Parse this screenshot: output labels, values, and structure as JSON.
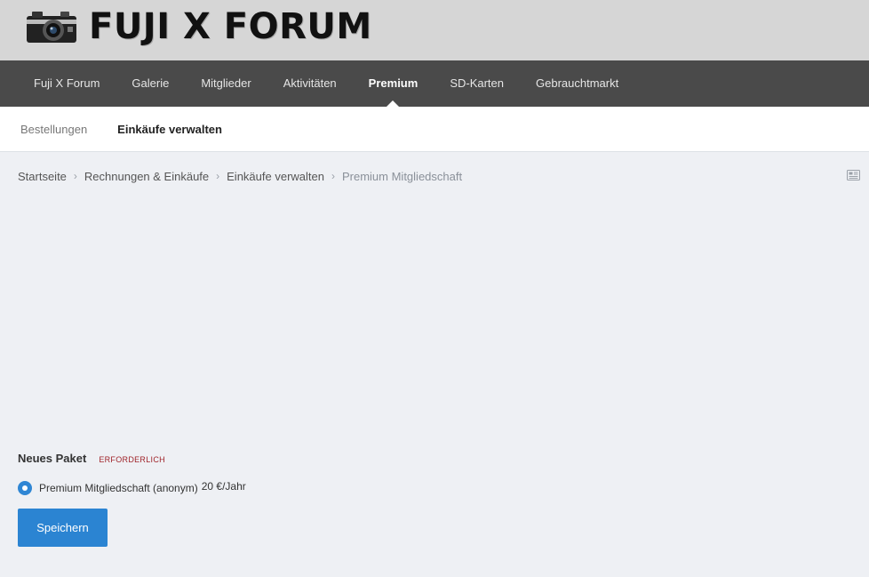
{
  "header": {
    "logo_text": "FUJI X FORUM"
  },
  "nav": {
    "items": [
      {
        "label": "Fuji X Forum"
      },
      {
        "label": "Galerie"
      },
      {
        "label": "Mitglieder"
      },
      {
        "label": "Aktivitäten"
      },
      {
        "label": "Premium",
        "active": true
      },
      {
        "label": "SD-Karten"
      },
      {
        "label": "Gebrauchtmarkt"
      }
    ]
  },
  "subnav": {
    "items": [
      {
        "label": "Bestellungen"
      },
      {
        "label": "Einkäufe verwalten",
        "active": true
      }
    ]
  },
  "breadcrumb": {
    "items": [
      "Startseite",
      "Rechnungen & Einkäufe",
      "Einkäufe verwalten",
      "Premium Mitgliedschaft"
    ]
  },
  "form": {
    "label": "Neues Paket",
    "required": "ERFORDERLICH",
    "option_label": "Premium Mitgliedschaft (anonym)",
    "option_price": "20 €/Jahr",
    "option_selected": true,
    "save_label": "Speichern"
  },
  "colors": {
    "nav_bg": "#4a4a4a",
    "header_bg": "#d6d6d6",
    "page_bg": "#eef0f4",
    "accent": "#2b84d2",
    "required": "#a0242a"
  }
}
